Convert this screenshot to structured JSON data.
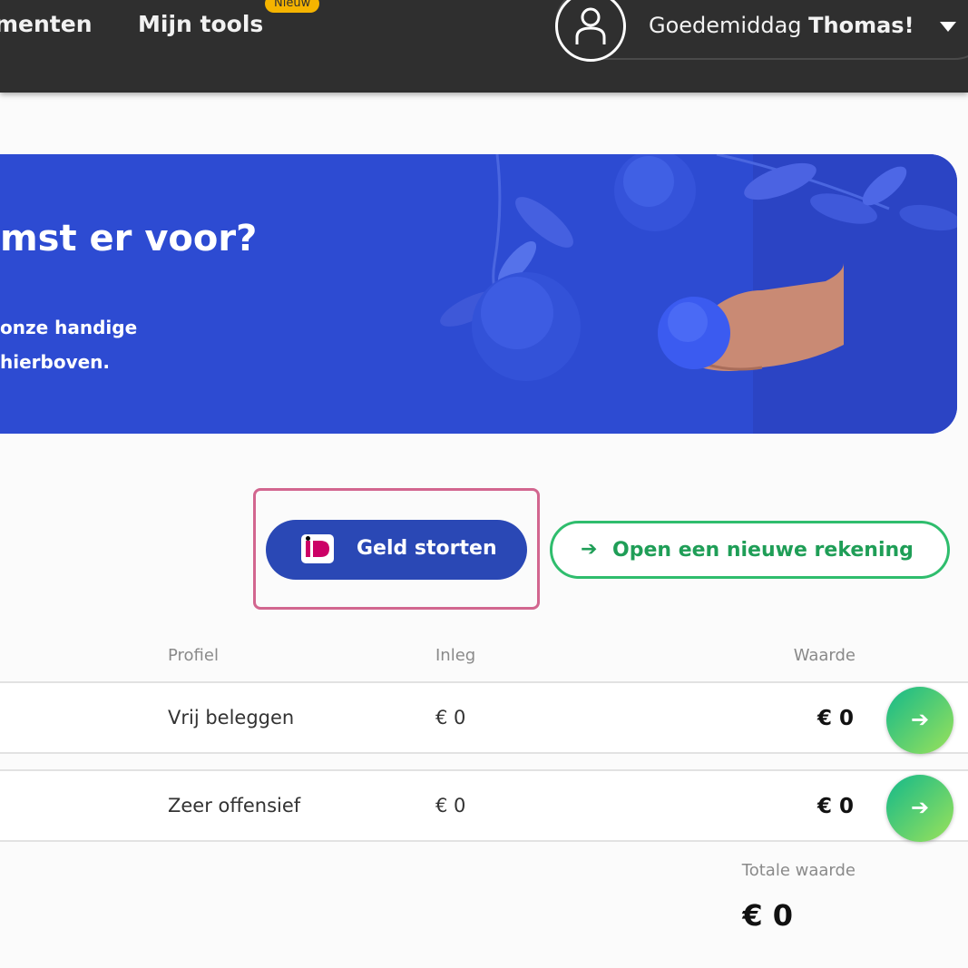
{
  "nav": {
    "items": [
      {
        "label": "menten"
      },
      {
        "label": "Mijn tools",
        "badge": "Nieuw"
      }
    ],
    "greeting_prefix": "Goedemiddag",
    "user_name": "Thomas!"
  },
  "hero": {
    "title": "mst er voor?",
    "line1": "onze handige",
    "line2": "hierboven."
  },
  "actions": {
    "deposit_label": "Geld storten",
    "deposit_icon": "ideal-icon",
    "open_account_label": "Open een nieuwe rekening",
    "open_account_icon": "arrow-right-icon"
  },
  "table": {
    "headers": {
      "profile": "Profiel",
      "inleg": "Inleg",
      "waarde": "Waarde"
    },
    "rows": [
      {
        "profile": "Vrij beleggen",
        "inleg": "€ 0",
        "waarde": "€ 0"
      },
      {
        "profile": "Zeer offensief",
        "inleg": "€ 0",
        "waarde": "€ 0"
      }
    ],
    "total_label": "Totale waarde",
    "total_value": "€ 0"
  },
  "colors": {
    "topbar": "#2f2f2f",
    "hero": "#2d4bd2",
    "primary_button": "#2a48b5",
    "success": "#2fbd6d",
    "highlight": "#d2668f",
    "badge": "#f5b400"
  }
}
